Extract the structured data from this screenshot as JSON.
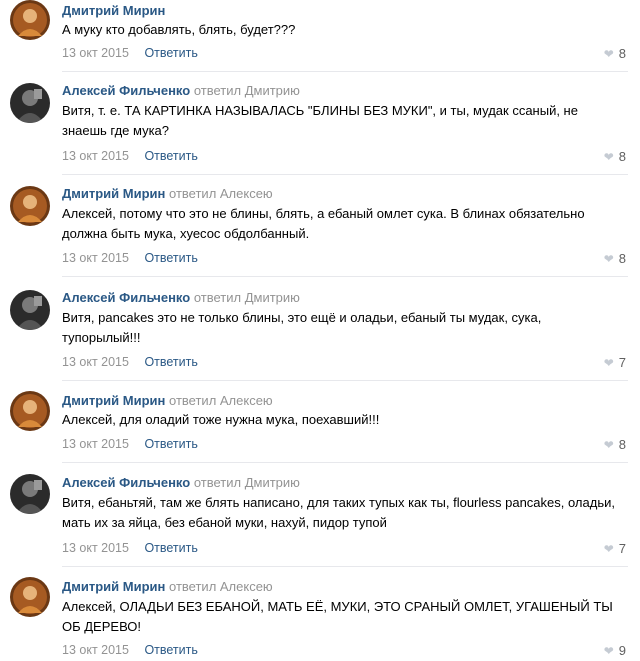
{
  "comments": [
    {
      "author": "Дмитрий Мирин",
      "replied": "",
      "text": "А муку кто добавлять, блять, будет???",
      "date": "13 окт 2015",
      "reply": "Ответить",
      "likes": "8"
    },
    {
      "author": "Алексей Фильченко",
      "replied": "ответил Дмитрию",
      "text": "Витя, т. е. ТА КАРТИНКА НАЗЫВАЛАСЬ \"БЛИНЫ БЕЗ МУКИ\", и ты, мудак ссаный, не знаешь где мука?",
      "date": "13 окт 2015",
      "reply": "Ответить",
      "likes": "8"
    },
    {
      "author": "Дмитрий Мирин",
      "replied": "ответил Алексею",
      "text": "Алексей, потому что это не блины, блять, а ебаный омлет сука. В блинах обязательно должна быть мука, хуесос обдолбанный.",
      "date": "13 окт 2015",
      "reply": "Ответить",
      "likes": "8"
    },
    {
      "author": "Алексей Фильченко",
      "replied": "ответил Дмитрию",
      "text": "Витя, pancakes это не только блины, это ещё и оладьи, ебаный ты мудак, сука, тупорылый!!!",
      "date": "13 окт 2015",
      "reply": "Ответить",
      "likes": "7"
    },
    {
      "author": "Дмитрий Мирин",
      "replied": "ответил Алексею",
      "text": "Алексей, для оладий тоже нужна мука, поехавший!!!",
      "date": "13 окт 2015",
      "reply": "Ответить",
      "likes": "8"
    },
    {
      "author": "Алексей Фильченко",
      "replied": "ответил Дмитрию",
      "text": "Витя, ебаньтяй, там же блять написано, для таких тупых как ты, flourless pancakes, оладьи, мать их за яйца, без ебаной муки, нахуй, пидор тупой",
      "date": "13 окт 2015",
      "reply": "Ответить",
      "likes": "7"
    },
    {
      "author": "Дмитрий Мирин",
      "replied": "ответил Алексею",
      "text": "Алексей, ОЛАДЬИ БЕЗ ЕБАНОЙ, МАТЬ ЕЁ, МУКИ, ЭТО СРАНЫЙ ОМЛЕТ, УГАШЕНЫЙ ТЫ ОБ ДЕРЕВО!",
      "date": "13 окт 2015",
      "reply": "Ответить",
      "likes": "9"
    }
  ],
  "colors": {
    "author": "#2a5885",
    "muted": "#939393",
    "heart": "#c5cbd3",
    "separator": "#e7e8ec",
    "dmitry_avatar": "#8a4a1e",
    "alexey_avatar": "#3a3a3a"
  },
  "icons": {
    "like": "heart-icon"
  }
}
